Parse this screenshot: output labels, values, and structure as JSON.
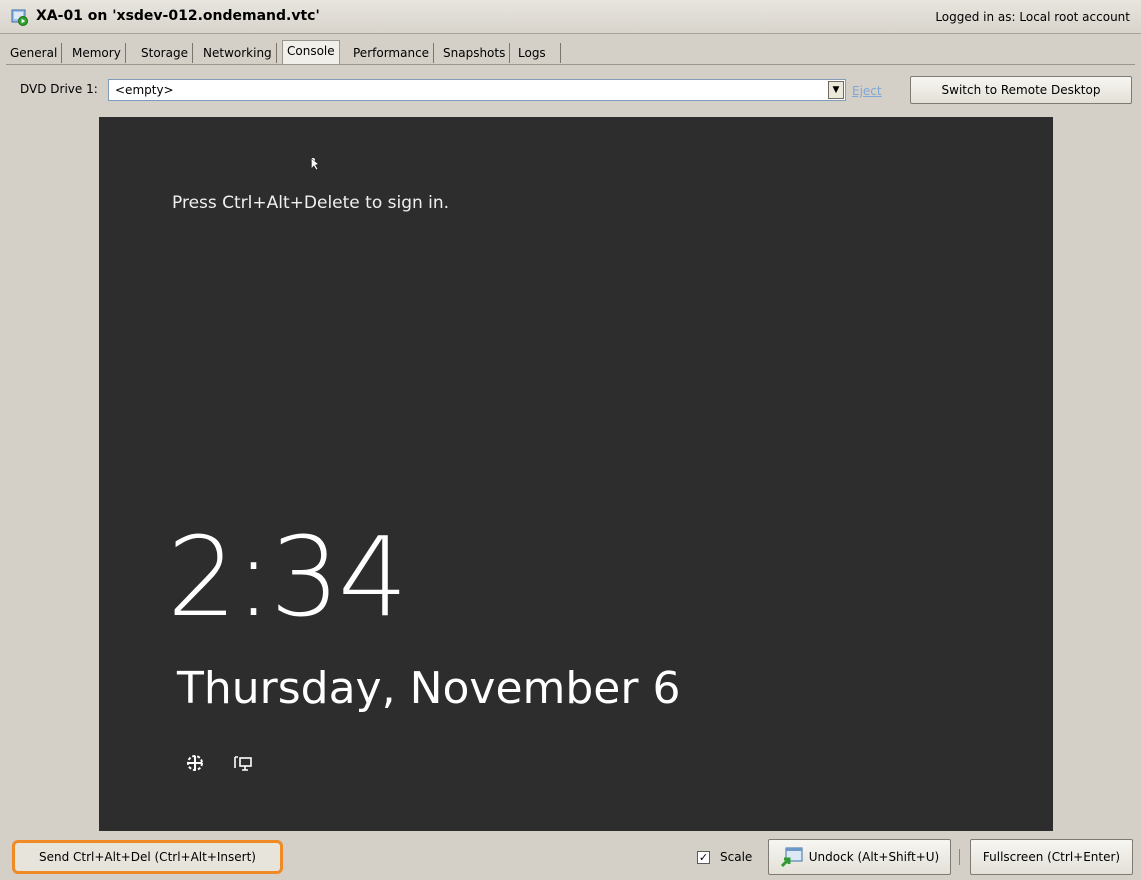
{
  "window": {
    "title": "XA-01 on 'xsdev-012.ondemand.vtc'",
    "logged_in": "Logged in as:  Local root account"
  },
  "tabs": [
    {
      "label": "General"
    },
    {
      "label": "Memory"
    },
    {
      "label": "Storage"
    },
    {
      "label": "Networking"
    },
    {
      "label": "Console",
      "active": true
    },
    {
      "label": "Performance"
    },
    {
      "label": "Snapshots"
    },
    {
      "label": "Logs"
    }
  ],
  "dvd": {
    "label": "DVD Drive 1:",
    "value": "<empty>",
    "eject": "Eject"
  },
  "remote_desktop_button": "Switch to Remote Desktop",
  "console": {
    "prompt": "Press Ctrl+Alt+Delete to sign in.",
    "time": "2:34",
    "date": "Thursday, November 6"
  },
  "bottom": {
    "send_cad": "Send Ctrl+Alt+Del (Ctrl+Alt+Insert)",
    "scale_label": "Scale",
    "scale_checked": true,
    "undock": "Undock (Alt+Shift+U)",
    "fullscreen": "Fullscreen (Ctrl+Enter)"
  },
  "colors": {
    "console_bg": "#2d2d2d",
    "highlight": "#f08a24",
    "eject_link": "#7fa6d9"
  }
}
